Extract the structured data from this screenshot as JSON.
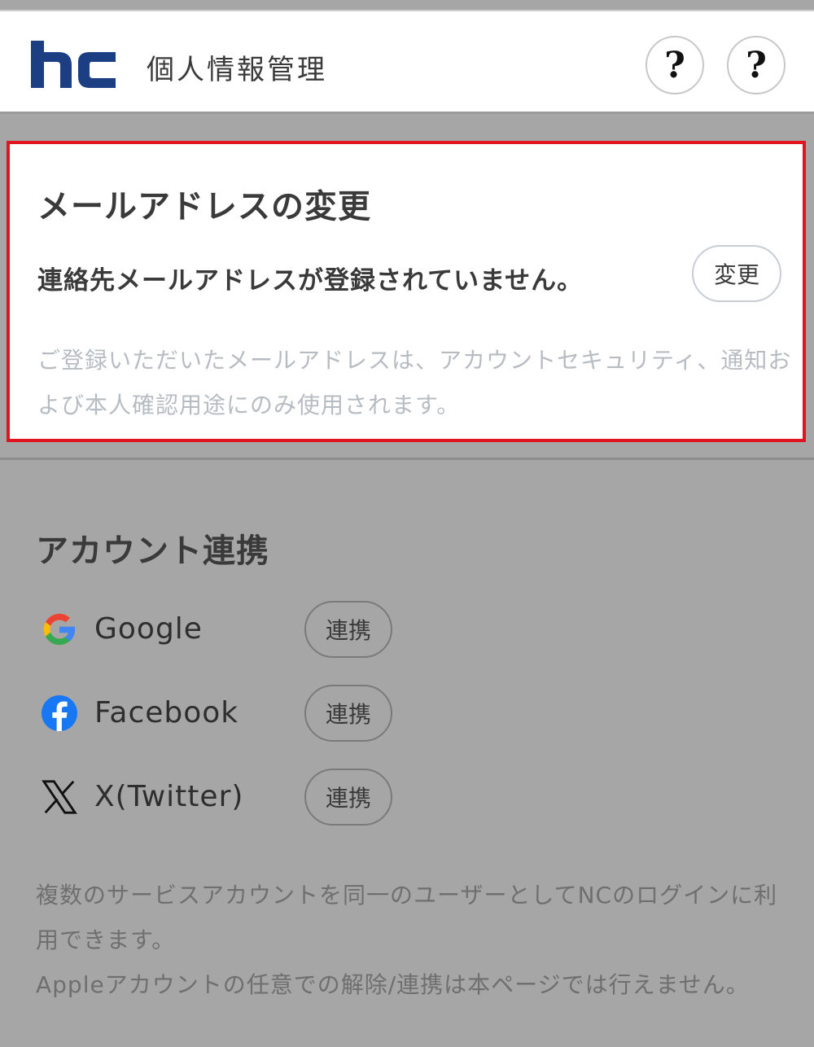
{
  "header": {
    "title": "個人情報管理",
    "help_buttons": [
      "?",
      "?"
    ]
  },
  "email_section": {
    "title": "メールアドレスの変更",
    "status": "連絡先メールアドレスが登録されていません。",
    "change_label": "変更",
    "description": "ご登録いただいたメールアドレスは、アカウントセキュリティ、通知および本人確認用途にのみ使用されます。"
  },
  "linking_section": {
    "title": "アカウント連携",
    "accounts": [
      {
        "name": "Google",
        "icon": "google-icon",
        "button_label": "連携"
      },
      {
        "name": "Facebook",
        "icon": "facebook-icon",
        "button_label": "連携"
      },
      {
        "name": "X(Twitter)",
        "icon": "x-icon",
        "button_label": "連携"
      }
    ],
    "note_1": "複数のサービスアカウントを同一のユーザーとしてNCのログインに利用できます。",
    "note_2": "Appleアカウントの任意での解除/連携は本ページでは行えません。"
  },
  "colors": {
    "brand": "#1b3f82",
    "highlight_border": "#e1131f",
    "overlay": "#a6a6a6",
    "facebook": "#1877f2"
  }
}
